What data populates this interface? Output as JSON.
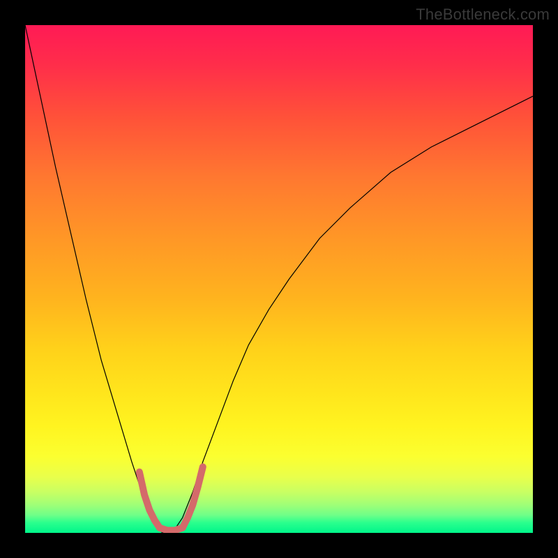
{
  "watermark": "TheBottleneck.com",
  "chart_data": {
    "type": "line",
    "title": "",
    "xlabel": "",
    "ylabel": "",
    "xlim": [
      0,
      1
    ],
    "ylim": [
      0,
      1
    ],
    "grid": false,
    "legend": false,
    "background_gradient": {
      "direction": "vertical",
      "stops": [
        {
          "pos": 0.0,
          "color": "#ff1a55"
        },
        {
          "pos": 0.5,
          "color": "#ffb41e"
        },
        {
          "pos": 0.8,
          "color": "#fff420"
        },
        {
          "pos": 0.92,
          "color": "#c8ff63"
        },
        {
          "pos": 1.0,
          "color": "#00f58a"
        }
      ]
    },
    "series": [
      {
        "name": "curve",
        "color": "#000000",
        "linewidth": 1.2,
        "x": [
          0.0,
          0.03,
          0.06,
          0.09,
          0.12,
          0.15,
          0.18,
          0.21,
          0.23,
          0.25,
          0.27,
          0.29,
          0.31,
          0.33,
          0.35,
          0.38,
          0.41,
          0.44,
          0.48,
          0.52,
          0.58,
          0.64,
          0.72,
          0.8,
          0.9,
          1.0
        ],
        "y": [
          1.0,
          0.86,
          0.72,
          0.59,
          0.46,
          0.34,
          0.24,
          0.14,
          0.08,
          0.03,
          0.0,
          0.0,
          0.03,
          0.08,
          0.14,
          0.22,
          0.3,
          0.37,
          0.44,
          0.5,
          0.58,
          0.64,
          0.71,
          0.76,
          0.81,
          0.86
        ]
      },
      {
        "name": "highlight_left",
        "color": "#d46a6a",
        "linewidth": 10,
        "linecap": "round",
        "x": [
          0.225,
          0.235,
          0.245,
          0.255,
          0.265
        ],
        "y": [
          0.12,
          0.075,
          0.045,
          0.025,
          0.01
        ]
      },
      {
        "name": "highlight_bottom",
        "color": "#d46a6a",
        "linewidth": 10,
        "linecap": "round",
        "x": [
          0.265,
          0.28,
          0.295,
          0.31
        ],
        "y": [
          0.01,
          0.005,
          0.005,
          0.01
        ]
      },
      {
        "name": "highlight_right",
        "color": "#d46a6a",
        "linewidth": 10,
        "linecap": "round",
        "x": [
          0.31,
          0.32,
          0.33,
          0.34,
          0.35
        ],
        "y": [
          0.01,
          0.03,
          0.055,
          0.09,
          0.13
        ]
      }
    ]
  }
}
